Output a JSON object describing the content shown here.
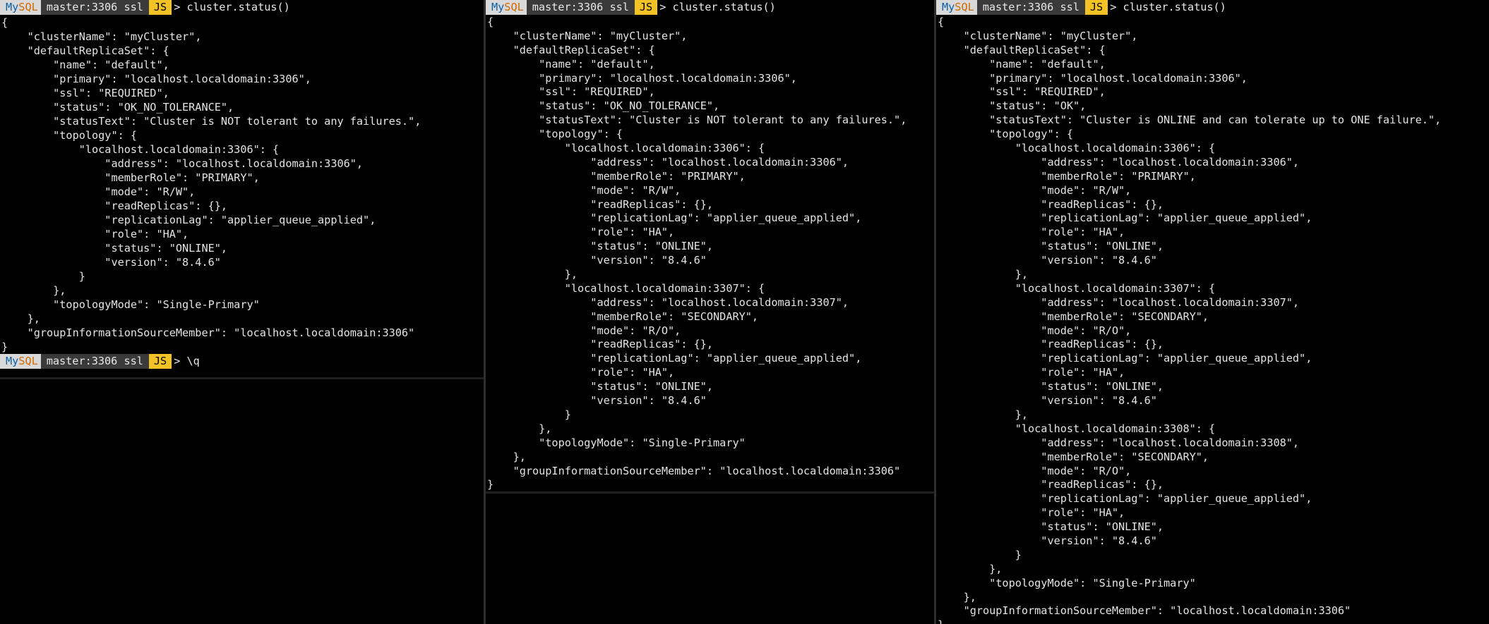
{
  "prompt": {
    "mysql_my": "My",
    "mysql_sql": "SQL",
    "connection": "master:3306 ssl",
    "mode": "JS",
    "arrow": ">"
  },
  "panes": {
    "left": {
      "command": "cluster.status()",
      "lines": [
        "{",
        "    \"clusterName\": \"myCluster\",",
        "    \"defaultReplicaSet\": {",
        "        \"name\": \"default\",",
        "        \"primary\": \"localhost.localdomain:3306\",",
        "        \"ssl\": \"REQUIRED\",",
        "        \"status\": \"OK_NO_TOLERANCE\",",
        "        \"statusText\": \"Cluster is NOT tolerant to any failures.\",",
        "        \"topology\": {",
        "            \"localhost.localdomain:3306\": {",
        "                \"address\": \"localhost.localdomain:3306\",",
        "                \"memberRole\": \"PRIMARY\",",
        "                \"mode\": \"R/W\",",
        "                \"readReplicas\": {},",
        "                \"replicationLag\": \"applier_queue_applied\",",
        "                \"role\": \"HA\",",
        "                \"status\": \"ONLINE\",",
        "                \"version\": \"8.4.6\"",
        "            }",
        "        },",
        "        \"topologyMode\": \"Single-Primary\"",
        "    },",
        "    \"groupInformationSourceMember\": \"localhost.localdomain:3306\"",
        "}"
      ],
      "second_command": "\\q"
    },
    "mid": {
      "command": "cluster.status()",
      "lines": [
        "{",
        "    \"clusterName\": \"myCluster\",",
        "    \"defaultReplicaSet\": {",
        "        \"name\": \"default\",",
        "        \"primary\": \"localhost.localdomain:3306\",",
        "        \"ssl\": \"REQUIRED\",",
        "        \"status\": \"OK_NO_TOLERANCE\",",
        "        \"statusText\": \"Cluster is NOT tolerant to any failures.\",",
        "        \"topology\": {",
        "            \"localhost.localdomain:3306\": {",
        "                \"address\": \"localhost.localdomain:3306\",",
        "                \"memberRole\": \"PRIMARY\",",
        "                \"mode\": \"R/W\",",
        "                \"readReplicas\": {},",
        "                \"replicationLag\": \"applier_queue_applied\",",
        "                \"role\": \"HA\",",
        "                \"status\": \"ONLINE\",",
        "                \"version\": \"8.4.6\"",
        "            },",
        "            \"localhost.localdomain:3307\": {",
        "                \"address\": \"localhost.localdomain:3307\",",
        "                \"memberRole\": \"SECONDARY\",",
        "                \"mode\": \"R/O\",",
        "                \"readReplicas\": {},",
        "                \"replicationLag\": \"applier_queue_applied\",",
        "                \"role\": \"HA\",",
        "                \"status\": \"ONLINE\",",
        "                \"version\": \"8.4.6\"",
        "            }",
        "        },",
        "        \"topologyMode\": \"Single-Primary\"",
        "    },",
        "    \"groupInformationSourceMember\": \"localhost.localdomain:3306\"",
        "}"
      ]
    },
    "right": {
      "command": "cluster.status()",
      "lines": [
        "{",
        "    \"clusterName\": \"myCluster\",",
        "    \"defaultReplicaSet\": {",
        "        \"name\": \"default\",",
        "        \"primary\": \"localhost.localdomain:3306\",",
        "        \"ssl\": \"REQUIRED\",",
        "        \"status\": \"OK\",",
        "        \"statusText\": \"Cluster is ONLINE and can tolerate up to ONE failure.\",",
        "        \"topology\": {",
        "            \"localhost.localdomain:3306\": {",
        "                \"address\": \"localhost.localdomain:3306\",",
        "                \"memberRole\": \"PRIMARY\",",
        "                \"mode\": \"R/W\",",
        "                \"readReplicas\": {},",
        "                \"replicationLag\": \"applier_queue_applied\",",
        "                \"role\": \"HA\",",
        "                \"status\": \"ONLINE\",",
        "                \"version\": \"8.4.6\"",
        "            },",
        "            \"localhost.localdomain:3307\": {",
        "                \"address\": \"localhost.localdomain:3307\",",
        "                \"memberRole\": \"SECONDARY\",",
        "                \"mode\": \"R/O\",",
        "                \"readReplicas\": {},",
        "                \"replicationLag\": \"applier_queue_applied\",",
        "                \"role\": \"HA\",",
        "                \"status\": \"ONLINE\",",
        "                \"version\": \"8.4.6\"",
        "            },",
        "            \"localhost.localdomain:3308\": {",
        "                \"address\": \"localhost.localdomain:3308\",",
        "                \"memberRole\": \"SECONDARY\",",
        "                \"mode\": \"R/O\",",
        "                \"readReplicas\": {},",
        "                \"replicationLag\": \"applier_queue_applied\",",
        "                \"role\": \"HA\",",
        "                \"status\": \"ONLINE\",",
        "                \"version\": \"8.4.6\"",
        "            }",
        "        },",
        "        \"topologyMode\": \"Single-Primary\"",
        "    },",
        "    \"groupInformationSourceMember\": \"localhost.localdomain:3306\"",
        "}"
      ]
    }
  }
}
